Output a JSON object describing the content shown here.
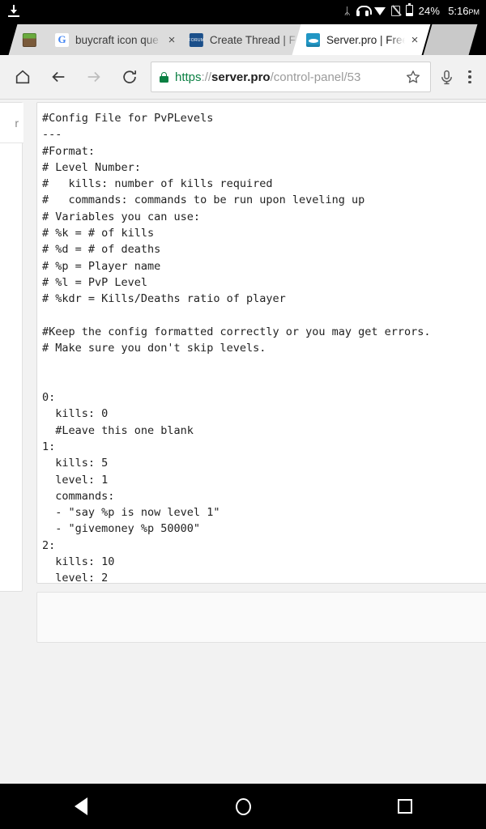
{
  "statusbar": {
    "download_icon": "download-icon",
    "bluetooth_icon": "bluetooth-icon",
    "bluetooth_glyph": "ᛦ",
    "headset_icon": "headset-icon",
    "wifi_icon": "wifi-icon",
    "signal_icon": "signal-off-icon",
    "battery_icon": "battery-icon",
    "battery_percent": "24%",
    "clock_time": "5:16",
    "clock_ampm": "PM"
  },
  "tabstrip": {
    "tabs": [
      {
        "title": "",
        "favicon": "minecraft-icon",
        "active": false,
        "close_label": ""
      },
      {
        "title": "buycraft icon que",
        "favicon": "google-icon",
        "active": false,
        "close_label": "×"
      },
      {
        "title": "Create Thread | F",
        "favicon": "forum-icon",
        "active": false,
        "close_label": ""
      },
      {
        "title": "Server.pro | Free",
        "favicon": "serverpro-globe-icon",
        "active": true,
        "close_label": "×"
      }
    ]
  },
  "toolbar": {
    "home_icon": "home-icon",
    "back_icon": "back-arrow-icon",
    "forward_icon": "forward-arrow-icon",
    "reload_icon": "reload-icon",
    "lock_icon": "lock-icon",
    "url_scheme": "https",
    "url_sep": "://",
    "url_host": "server.pro",
    "url_path": "/control-panel/53",
    "bookmark_icon": "star-icon",
    "mic_icon": "microphone-icon",
    "menu_icon": "overflow-menu-icon"
  },
  "page": {
    "side_card_text": "r",
    "editor_value": "#Config File for PvPLevels\n---\n#Format:\n# Level Number:\n#   kills: number of kills required\n#   commands: commands to be run upon leveling up\n# Variables you can use:\n# %k = # of kills\n# %d = # of deaths\n# %p = Player name\n# %l = PvP Level\n# %kdr = Kills/Deaths ratio of player\n\n#Keep the config formatted correctly or you may get errors.\n# Make sure you don't skip levels.\n\n\n0:\n  kills: 0\n  #Leave this one blank\n1:\n  kills: 5\n  level: 1\n  commands:\n  - \"say %p is now level 1\"\n  - \"givemoney %p 50000\"\n2:\n  kills: 10\n  level: 2",
    "editor_placeholder": ""
  },
  "navbar": {
    "back_icon": "android-back-icon",
    "home_icon": "android-home-icon",
    "recents_icon": "android-recents-icon"
  },
  "colors": {
    "accent_green": "#0b8043",
    "tab_active_bg": "#ffffff",
    "toolbar_bg": "#f1f1f1",
    "page_bg": "#f2f2f2",
    "system_black": "#000000"
  }
}
